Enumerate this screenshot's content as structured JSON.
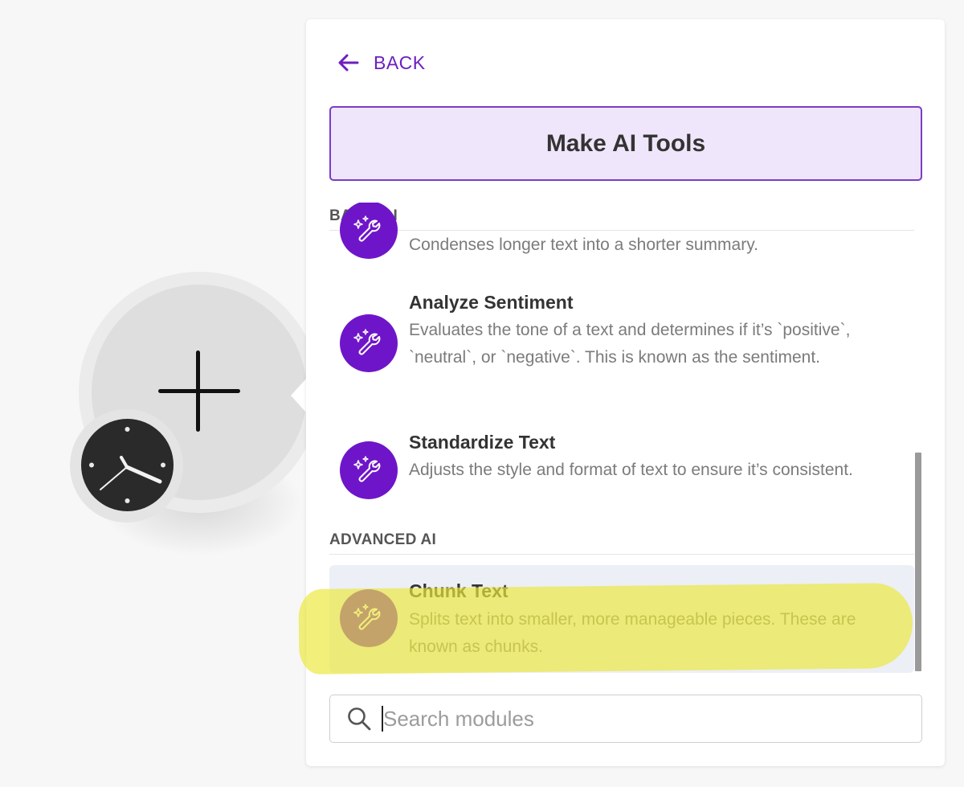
{
  "back": {
    "label": "BACK"
  },
  "header": {
    "title": "Make AI Tools"
  },
  "sections": {
    "basic": {
      "label": "BASIC AI"
    },
    "advanced": {
      "label": "ADVANCED AI"
    }
  },
  "items": {
    "summarize": {
      "description": "Condenses longer text into a shorter summary."
    },
    "sentiment": {
      "name": "Analyze Sentiment",
      "description": "Evaluates the tone of a text and determines if it’s `positive`, `neutral`, or `negative`. This is known as the sentiment."
    },
    "standardize": {
      "name": "Standardize Text",
      "description": "Adjusts the style and format of text to ensure it’s consistent."
    },
    "chunk": {
      "name": "Chunk Text",
      "description": "Splits text into smaller, more manageable pieces. These are known as chunks."
    }
  },
  "search": {
    "placeholder": "Search modules",
    "value": ""
  },
  "colors": {
    "accent": "#6d1fbf",
    "icon_bg": "#6e15c9",
    "header_bg": "#f0e6fb",
    "highlight": "#ece83c"
  },
  "icons": {
    "back": "arrow-left-icon",
    "module": "sparkle-wrench-icon",
    "search": "search-icon",
    "add": "plus-icon",
    "trigger": "clock-icon"
  }
}
